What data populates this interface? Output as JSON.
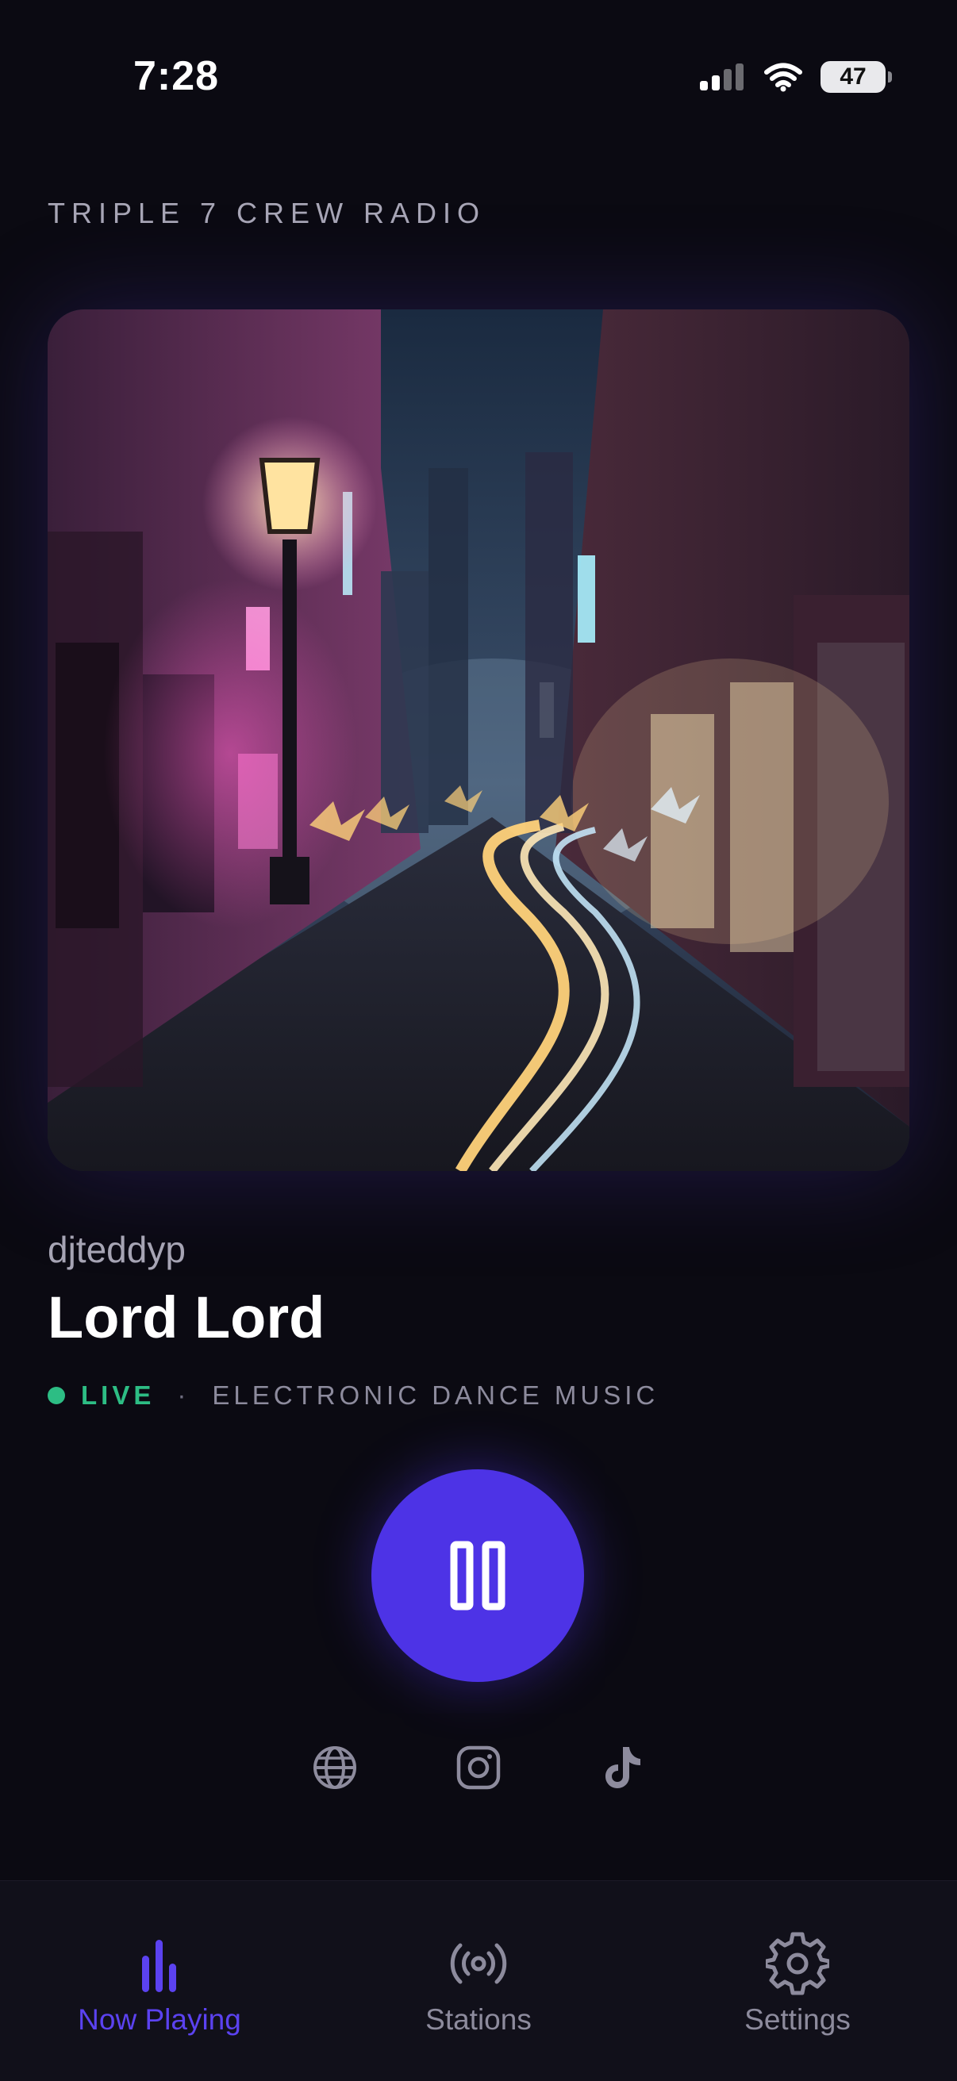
{
  "status_bar": {
    "time": "7:28",
    "battery": "47"
  },
  "station": {
    "name": "TRIPLE 7 CREW RADIO"
  },
  "now_playing": {
    "artist": "djteddyp",
    "title": "Lord Lord",
    "live_label": "LIVE",
    "separator": "·",
    "genre": "ELECTRONIC DANCE MUSIC",
    "playback_state": "playing"
  },
  "social_links": [
    {
      "name": "globe-icon"
    },
    {
      "name": "instagram-icon"
    },
    {
      "name": "tiktok-icon"
    }
  ],
  "tabs": [
    {
      "label": "Now Playing",
      "icon": "equalizer-icon",
      "active": true
    },
    {
      "label": "Stations",
      "icon": "broadcast-icon",
      "active": false
    },
    {
      "label": "Settings",
      "icon": "gear-icon",
      "active": false
    }
  ],
  "colors": {
    "background": "#0b0a12",
    "accent": "#4d33e6",
    "live": "#2dbd84",
    "tab_active": "#5b42f0",
    "muted": "#8d8b9d"
  }
}
